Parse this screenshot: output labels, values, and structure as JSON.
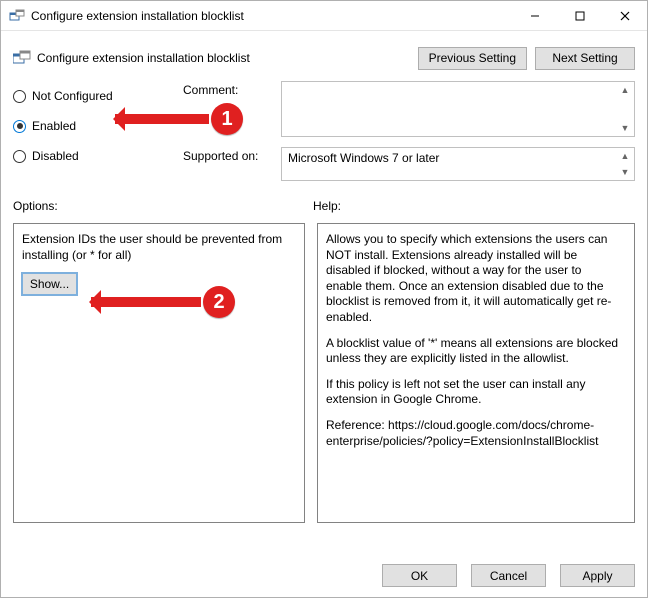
{
  "window": {
    "title": "Configure extension installation blocklist"
  },
  "header": {
    "label": "Configure extension installation blocklist",
    "prev_btn": "Previous Setting",
    "next_btn": "Next Setting"
  },
  "state": {
    "options": {
      "not_configured": "Not Configured",
      "enabled": "Enabled",
      "disabled": "Disabled"
    },
    "selected": "Enabled",
    "comment_label": "Comment:",
    "comment_value": "",
    "supported_label": "Supported on:",
    "supported_value": "Microsoft Windows 7 or later"
  },
  "sections": {
    "options_label": "Options:",
    "help_label": "Help:"
  },
  "options_panel": {
    "text": "Extension IDs the user should be prevented from installing (or * for all)",
    "show_btn": "Show..."
  },
  "help_panel": {
    "p1": "Allows you to specify which extensions the users can NOT install. Extensions already installed will be disabled if blocked, without a way for the user to enable them. Once an extension disabled due to the blocklist is removed from it, it will automatically get re-enabled.",
    "p2": "A blocklist value of '*' means all extensions are blocked unless they are explicitly listed in the allowlist.",
    "p3": "If this policy is left not set the user can install any extension in Google Chrome.",
    "p4": "Reference: https://cloud.google.com/docs/chrome-enterprise/policies/?policy=ExtensionInstallBlocklist"
  },
  "buttons": {
    "ok": "OK",
    "cancel": "Cancel",
    "apply": "Apply"
  },
  "annotations": {
    "one": "1",
    "two": "2"
  }
}
